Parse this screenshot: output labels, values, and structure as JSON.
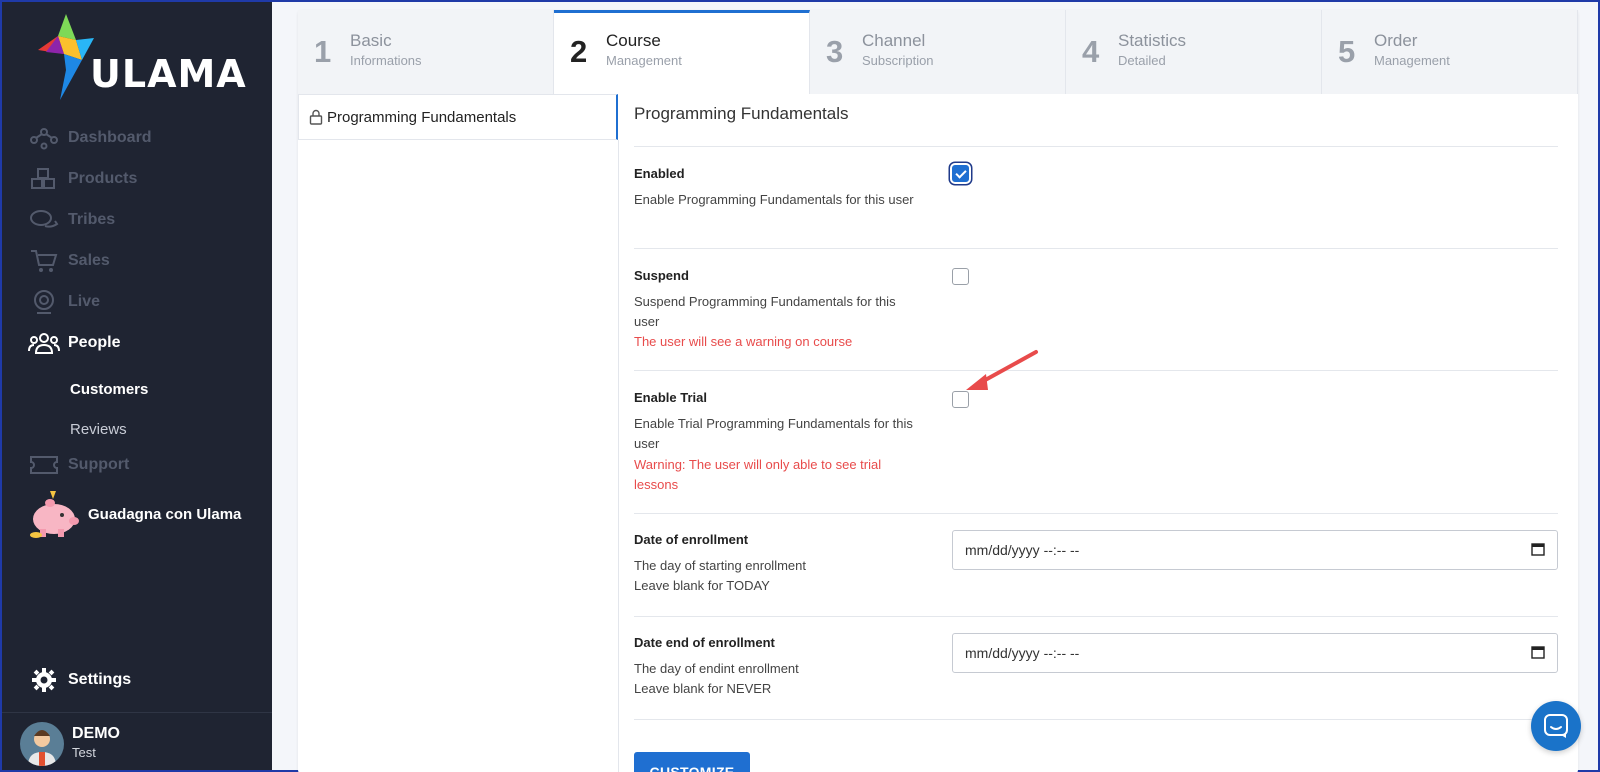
{
  "brand": {
    "name": "ULAMA"
  },
  "sidebar": {
    "items": [
      {
        "label": "Dashboard",
        "icon": "dashboard-icon"
      },
      {
        "label": "Products",
        "icon": "cubes-icon"
      },
      {
        "label": "Tribes",
        "icon": "chat-bubbles-icon"
      },
      {
        "label": "Sales",
        "icon": "cart-icon"
      },
      {
        "label": "Live",
        "icon": "webcam-icon"
      },
      {
        "label": "People",
        "icon": "people-icon"
      }
    ],
    "sub_items": [
      {
        "label": "Customers"
      },
      {
        "label": "Reviews"
      }
    ],
    "support": {
      "label": "Support",
      "icon": "ticket-icon"
    },
    "promo": {
      "label": "Guadagna con Ulama",
      "icon": "piggy-bank-icon"
    },
    "settings": {
      "label": "Settings",
      "icon": "gear-icon"
    },
    "user": {
      "name": "DEMO",
      "sub": "Test"
    }
  },
  "steps": [
    {
      "num": "1",
      "title": "Basic",
      "subtitle": "Informations"
    },
    {
      "num": "2",
      "title": "Course",
      "subtitle": "Management"
    },
    {
      "num": "3",
      "title": "Channel",
      "subtitle": "Subscription"
    },
    {
      "num": "4",
      "title": "Statistics",
      "subtitle": "Detailed"
    },
    {
      "num": "5",
      "title": "Order",
      "subtitle": "Management"
    }
  ],
  "course_tab": {
    "label": "Programming Fundamentals"
  },
  "form": {
    "title": "Programming Fundamentals",
    "enabled": {
      "label": "Enabled",
      "desc": "Enable Programming Fundamentals for this user",
      "checked": true
    },
    "suspend": {
      "label": "Suspend",
      "desc": "Suspend Programming Fundamentals for this user",
      "warning": "The user will see a warning on course",
      "checked": false
    },
    "trial": {
      "label": "Enable Trial",
      "desc": "Enable Trial Programming Fundamentals for this user",
      "warning": "Warning: The user will only able to see trial lessons",
      "checked": false
    },
    "date_start": {
      "label": "Date of enrollment",
      "desc1": "The day of starting enrollment",
      "desc2": "Leave blank for TODAY",
      "placeholder": "mm/dd/yyyy --:-- --"
    },
    "date_end": {
      "label": "Date end of enrollment",
      "desc1": "The day of endint enrollment",
      "desc2": "Leave blank for NEVER",
      "placeholder": "mm/dd/yyyy --:-- --"
    },
    "customize_button": "CUSTOMIZE"
  },
  "colors": {
    "sidebar_bg": "#1f2432",
    "accent": "#1f6fd1",
    "warning": "#e84b4b"
  }
}
